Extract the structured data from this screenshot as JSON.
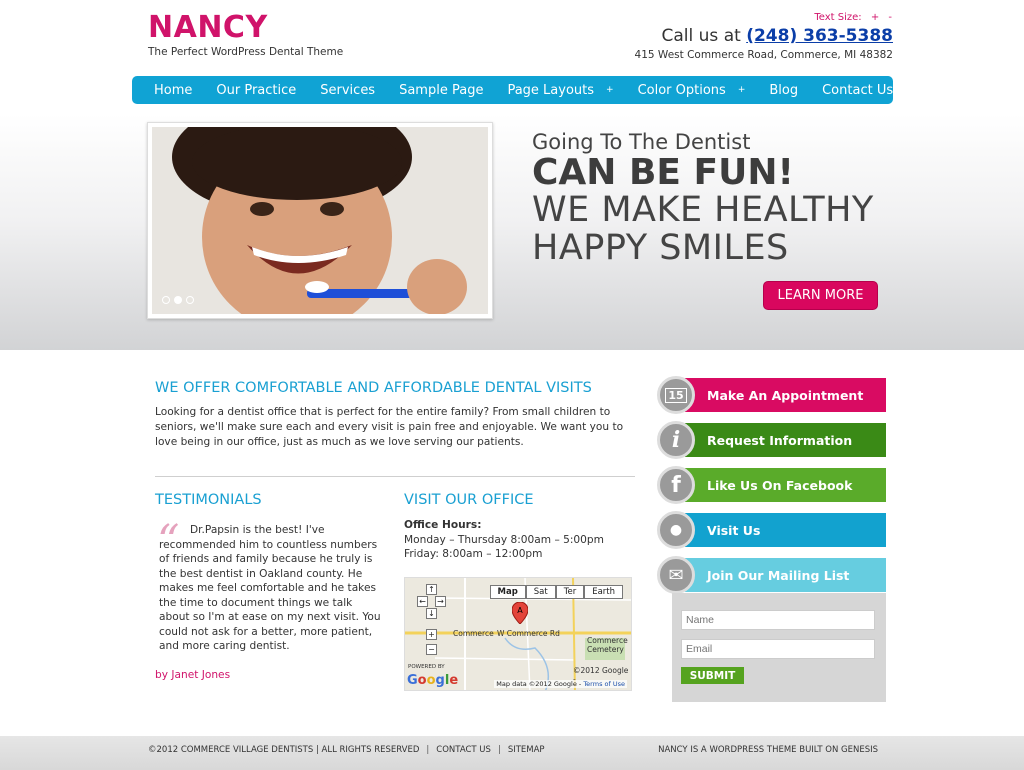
{
  "header": {
    "logo": "NANCY",
    "tagline": "The Perfect WordPress Dental Theme",
    "text_size_label": "Text Size:",
    "text_size_increase": "+",
    "text_size_decrease": "-",
    "call_prefix": "Call us at",
    "phone": "(248) 363-5388",
    "address": "415 West Commerce Road, Commerce, MI 48382"
  },
  "nav": {
    "items": [
      {
        "label": "Home"
      },
      {
        "label": "Our Practice"
      },
      {
        "label": "Services"
      },
      {
        "label": "Sample Page"
      },
      {
        "label": "Page Layouts",
        "submenu": "+"
      },
      {
        "label": "Color Options",
        "submenu": "+"
      },
      {
        "label": "Blog"
      },
      {
        "label": "Contact Us"
      }
    ]
  },
  "hero": {
    "subtitle": "Going To The Dentist",
    "headline": "CAN BE FUN!",
    "line1": "WE MAKE HEALTHY",
    "line2": "HAPPY SMILES",
    "button": "LEARN MORE",
    "slide_count": 3,
    "active_slide": 2
  },
  "intro": {
    "title": "WE OFFER COMFORTABLE AND AFFORDABLE DENTAL VISITS",
    "text": "Looking for a dentist office that is perfect for the entire family? From small children to seniors, we'll make sure each and every visit is pain free and enjoyable. We want you to love being in our office, just as much as we love serving our patients."
  },
  "testimonials": {
    "title": "TESTIMONIALS",
    "quote_mark": "“",
    "text": "Dr.Papsin is the best! I've recommended him to countless numbers of friends and family because he truly is the best dentist in Oakland county. He makes me feel comfortable and he takes the time to document things we talk about so I'm at ease on my next visit. You could not ask for a better, more patient, and more caring dentist.",
    "author": "by Janet Jones"
  },
  "visit": {
    "title": "VISIT OUR OFFICE",
    "hours_label": "Office Hours:",
    "hours": [
      "Monday – Thursday 8:00am – 5:00pm",
      "Friday: 8:00am – 12:00pm"
    ],
    "map": {
      "tabs": [
        "Map",
        "Sat",
        "Ter",
        "Earth"
      ],
      "active_tab": "Map",
      "marker": "A",
      "street1": "Commerce",
      "street2": "W Commerce Rd",
      "cemetery": "Commerce Cemetery",
      "powered": "POWERED BY",
      "logo": "Google",
      "copyright": "©2012 Google -",
      "data_text": "Map data ©2012 Google -",
      "terms": "Terms of Use"
    }
  },
  "sidebar": {
    "buttons": [
      {
        "label": "Make An Appointment",
        "color": "#d90b62",
        "icon": "calendar-icon",
        "glyph": "15"
      },
      {
        "label": "Request Information",
        "color": "#3a8a16",
        "icon": "info-icon",
        "glyph": "i"
      },
      {
        "label": "Like Us On Facebook",
        "color": "#5aab2a",
        "icon": "facebook-icon",
        "glyph": "f"
      },
      {
        "label": "Visit Us",
        "color": "#12a2cf",
        "icon": "location-pin-icon",
        "glyph": "●"
      },
      {
        "label": "Join Our Mailing List",
        "color": "#66cde0",
        "icon": "envelope-icon",
        "glyph": "✉"
      }
    ],
    "mailing": {
      "name_placeholder": "Name",
      "email_placeholder": "Email",
      "submit": "SUBMIT"
    }
  },
  "footer": {
    "copyright": "©2012 COMMERCE VILLAGE DENTISTS | ALL RIGHTS RESERVED",
    "contact": "CONTACT US",
    "sitemap": "SITEMAP",
    "credit": "NANCY IS A WORDPRESS THEME BUILT ON GENESIS"
  }
}
